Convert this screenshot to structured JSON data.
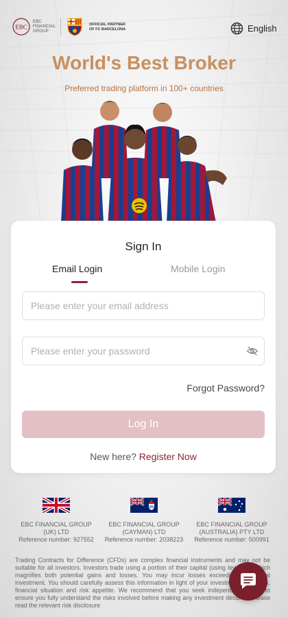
{
  "header": {
    "ebc_logo_text": [
      "EBC",
      "FINANCIAL",
      "GROUP"
    ],
    "partner_text": [
      "OFFICIAL PARTNER",
      "OF FC BARCELONA"
    ],
    "language": "English"
  },
  "hero": {
    "headline": "World's Best Broker",
    "subheadline": "Preferred trading platform in 100+ countries"
  },
  "signin": {
    "title": "Sign In",
    "tabs": [
      {
        "label": "Email Login",
        "active": true
      },
      {
        "label": "Mobile Login",
        "active": false
      }
    ],
    "email_placeholder": "Please enter your email address",
    "password_placeholder": "Please enter your password",
    "forgot_label": "Forgot Password?",
    "login_label": "Log In",
    "register_prompt": "New here?",
    "register_link": "Register Now"
  },
  "entities": [
    {
      "name": "EBC FINANCIAL GROUP (UK) LTD",
      "ref": "Reference number: 927552",
      "flag": "uk-flag"
    },
    {
      "name": "EBC FINANCIAL GROUP (CAYMAN) LTD",
      "ref": "Reference number: 2038223",
      "flag": "cayman-flag"
    },
    {
      "name": "EBC FINANCIAL GROUP (AUSTRALIA) PTY LTD",
      "ref": "Reference number: 500991",
      "flag": "australia-flag"
    }
  ],
  "disclaimer": "Trading Contracts for Difference (CFDs) are complex financial instruments and may not be suitable for all investors. Investors trade using a portion of their capital (using leverage, which magnifies both potential gains and losses. You may incur losses exceeding your initial investment. You should carefully assess this information in light of your investment objectives, financial situation and risk appetite. We recommend that you seek independent advice to ensure you fully understand the risks involved before making any investment decision. Please read the relevant risk disclosure",
  "colors": {
    "accent": "#8b2330",
    "headline": "#c89060",
    "login_button": "#e3c0c4",
    "chat_button": "#7a1f2b"
  },
  "icons": {
    "language": "globe-icon",
    "password_toggle": "eye-off-icon",
    "chat": "chat-icon"
  }
}
